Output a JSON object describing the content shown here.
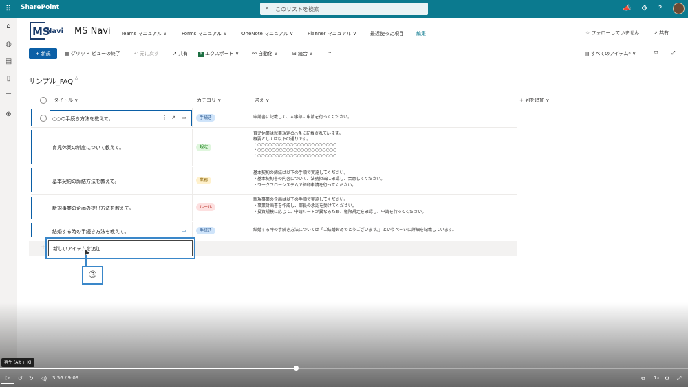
{
  "topbar": {
    "app_name": "SharePoint",
    "search_placeholder": "このリストを検索"
  },
  "site": {
    "title": "MS Navi",
    "logo_letters": "MS",
    "logo_sub": "Navi",
    "nav": [
      "Teams マニュアル ∨",
      "Forms マニュアル ∨",
      "OneNote マニュアル ∨",
      "Planner マニュアル ∨",
      "最近使った項目",
      "編集"
    ],
    "follow": "☆ フォローしていません",
    "share": "共有"
  },
  "commandbar": {
    "new": "新規",
    "exit_grid": "グリッド ビューの終了",
    "undo": "元に戻す",
    "share": "共有",
    "export": "エクスポート ∨",
    "automate": "自動化 ∨",
    "integrate": "統合 ∨",
    "more": "···",
    "view": "すべてのアイテム* ∨"
  },
  "list": {
    "title": "サンプル_FAQ",
    "columns": {
      "title": "タイトル ∨",
      "category": "カテゴリ ∨",
      "answer": "答え ∨",
      "add_column": "+ 列を追加 ∨"
    },
    "rows": [
      {
        "title": "○○の手続き方法を教えて。",
        "category": "手続き",
        "answer": [
          "申請書に記載して、人事部に申請を行ってください。"
        ]
      },
      {
        "title": "育児休業の制度について教えて。",
        "category": "規定",
        "answer": [
          "育児休業は就業規定の○条に記載されています。",
          "概要としては以下の通りです。",
          "・○○○○○○○○○○○○○○○○○○○○○○",
          "・○○○○○○○○○○○○○○○○○○○○○○",
          "・○○○○○○○○○○○○○○○○○○○○○○"
        ]
      },
      {
        "title": "基本契約の締結方法を教えて。",
        "category": "業務",
        "answer": [
          "基本契約の締結は以下の手順で実施してください。",
          "・基本契約書の内容について、法務担当に確認し、合意してください。",
          "・ワークフローシステムで締印申請を行ってください。"
        ]
      },
      {
        "title": "新規事業の企画の提出方法を教えて。",
        "category": "ルール",
        "answer": [
          "新規事業の企画は以下の手順で実施してください。",
          "・事業計画書を作成し、部長の承認を受けてください。",
          "・投資規模に応じて、申請ルートが異なるため、権限規定を確認し、申請を行ってください。"
        ]
      },
      {
        "title": "結婚する時の手続き方法を教えて。",
        "category": "手続き",
        "answer": [
          "結婚する時の手続き方法については「ご結婚おめでとうございます。」というページに詳細を記載しています。"
        ]
      }
    ],
    "new_item_placeholder": "新しいアイテムを追加"
  },
  "annotation": {
    "step": "③"
  },
  "video": {
    "tooltip": "再生 (Alt + K)",
    "time": "3:56 / 9:09",
    "speed": "1x",
    "progress": 0.43
  },
  "colors": {
    "accent": "#0b5fa6",
    "topbar": "#0b7a8f",
    "highlight": "#3a87c9"
  }
}
